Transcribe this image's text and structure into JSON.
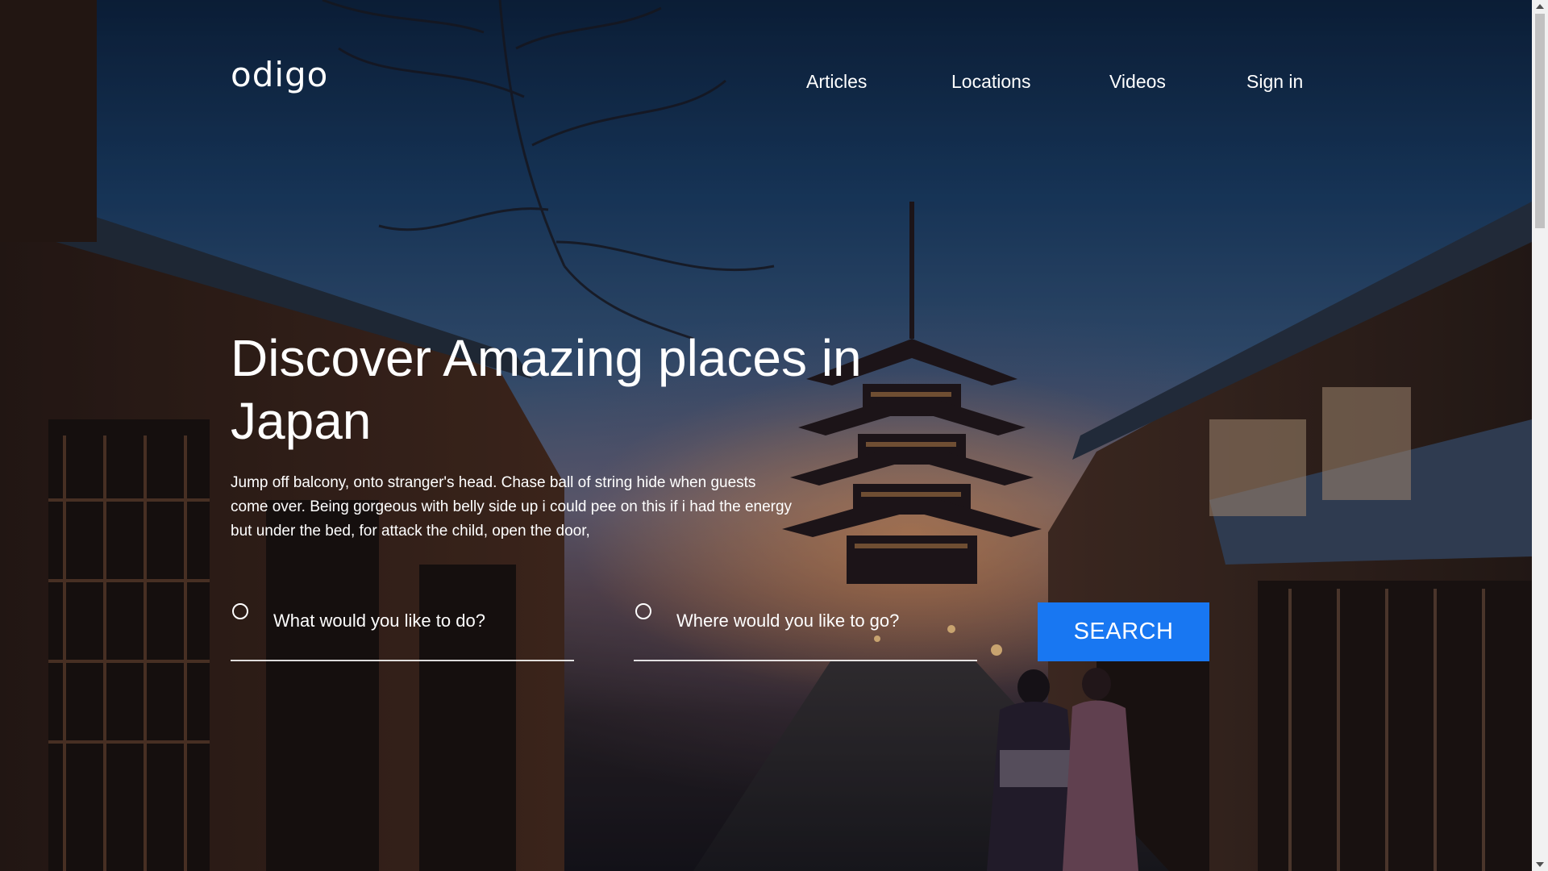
{
  "brand": {
    "logo_text": "odigo"
  },
  "nav": {
    "items": [
      {
        "label": "Articles"
      },
      {
        "label": "Locations"
      },
      {
        "label": "Videos"
      },
      {
        "label": "Sign in"
      }
    ]
  },
  "hero": {
    "headline": "Discover Amazing places in Japan",
    "description": "Jump off balcony, onto stranger's head. Chase ball of string hide when guests come over. Being gorgeous with belly side up i could pee on this if i had the energy but under the bed, for attack the child, open the door,"
  },
  "search": {
    "what_placeholder": "What would you like to do?",
    "where_placeholder": "Where would you like to go?",
    "button_label": "SEARCH"
  },
  "colors": {
    "accent": "#1877f2",
    "text": "#ffffff"
  }
}
